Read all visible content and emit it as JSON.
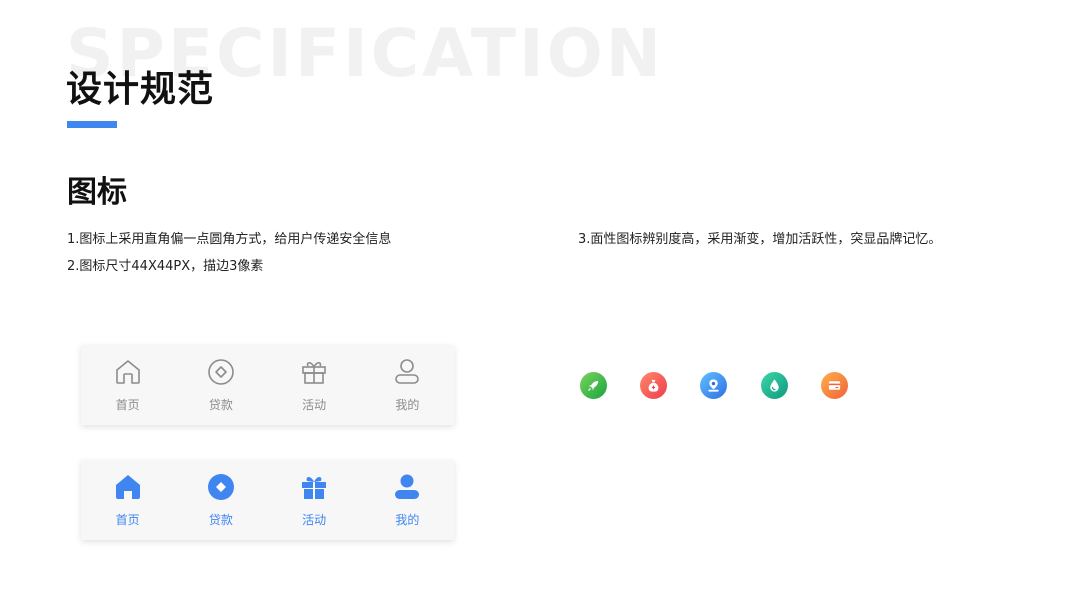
{
  "watermark": "SPECIFICATION",
  "page_title": "设计规范",
  "section_title": "图标",
  "descriptions": [
    "1.图标上采用直角偏一点圆角方式，给用户传递安全信息",
    "2.图标尺寸44X44PX，描边3像素",
    "3.面性图标辨别度高，采用渐变，增加活跃性，突显品牌记忆。"
  ],
  "colors": {
    "accent": "#3f86f0",
    "inactive": "#8c8c8c",
    "tabbar_bg": "#f7f7f8"
  },
  "tabbar_outline": {
    "items": [
      {
        "label": "首页",
        "icon": "home-outline-icon"
      },
      {
        "label": "贷款",
        "icon": "loan-outline-icon"
      },
      {
        "label": "活动",
        "icon": "gift-outline-icon"
      },
      {
        "label": "我的",
        "icon": "user-outline-icon"
      }
    ]
  },
  "tabbar_filled": {
    "items": [
      {
        "label": "首页",
        "icon": "home-filled-icon"
      },
      {
        "label": "贷款",
        "icon": "loan-filled-icon"
      },
      {
        "label": "活动",
        "icon": "gift-filled-icon"
      },
      {
        "label": "我的",
        "icon": "user-filled-icon"
      }
    ]
  },
  "gradient_icons": [
    {
      "icon": "rocket-icon",
      "color_from": "#7bd35c",
      "color_to": "#19a43f"
    },
    {
      "icon": "money-bag-icon",
      "color_from": "#ff8a6a",
      "color_to": "#ef3b4e"
    },
    {
      "icon": "location-pin-icon",
      "color_from": "#5fc0ff",
      "color_to": "#2f6fe4"
    },
    {
      "icon": "water-drop-icon",
      "color_from": "#3fd6a6",
      "color_to": "#0b9a80"
    },
    {
      "icon": "card-icon",
      "color_from": "#ffb04a",
      "color_to": "#f2613a"
    }
  ]
}
